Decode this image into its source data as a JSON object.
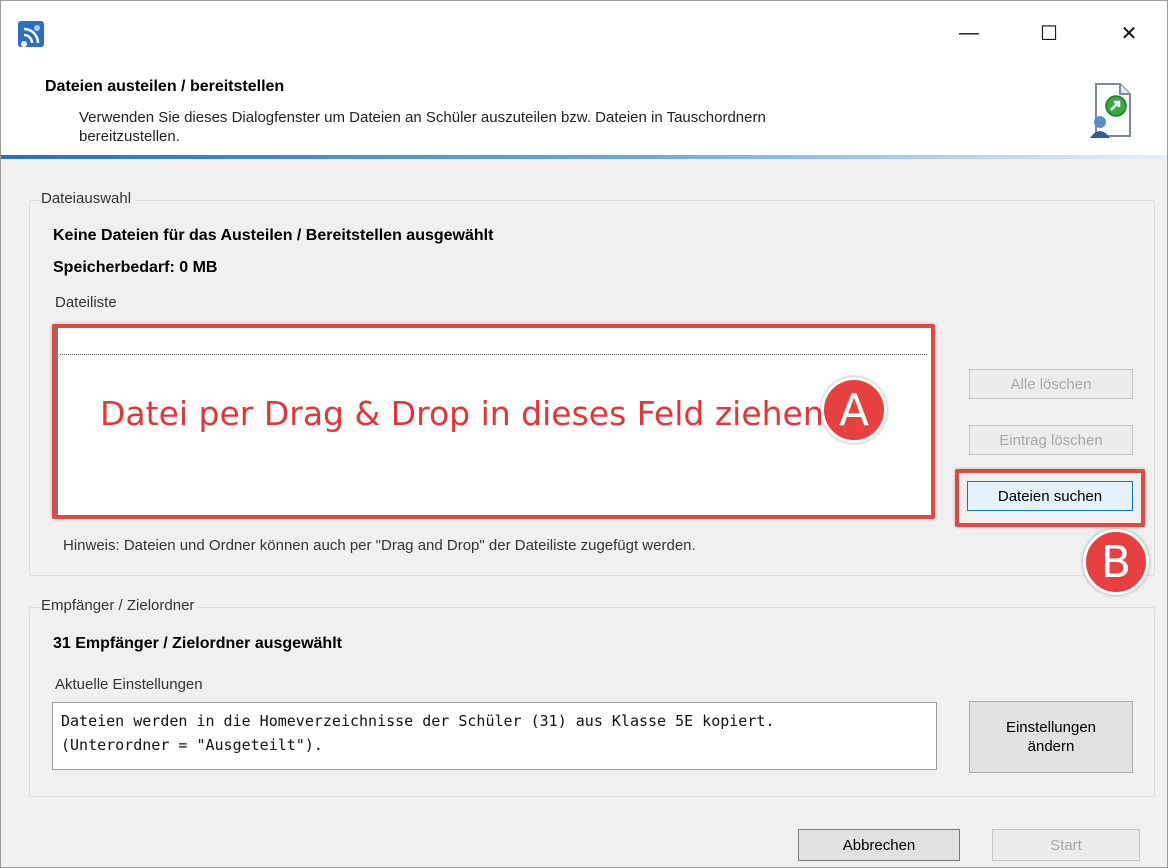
{
  "window": {
    "app_icon": "network-share-icon",
    "controls": {
      "minimize": "—",
      "maximize": "☐",
      "close": "✕"
    }
  },
  "header": {
    "title": "Dateien austeilen / bereitstellen",
    "description_line1": "Verwenden Sie dieses Dialogfenster um Dateien an Schüler auszuteilen bzw. Dateien in Tauschordnern",
    "description_line2": "bereitzustellen.",
    "icon": "file-distribution-icon",
    "accent_color": "#1f73c6"
  },
  "file_selection": {
    "group_label": "Dateiauswahl",
    "status": "Keine Dateien für das Austeilen / Bereitstellen ausgewählt",
    "memory": "Speicherbedarf: 0 MB",
    "list_label": "Dateiliste",
    "drop_hint": "Datei per Drag & Drop in dieses Feld ziehen",
    "marker_a": "A",
    "marker_b": "B",
    "buttons": {
      "delete_all": "Alle löschen",
      "delete_entry": "Eintrag löschen",
      "browse": "Dateien suchen"
    },
    "note": "Hinweis: Dateien und Ordner können auch per \"Drag and Drop\" der Dateiliste zugefügt werden."
  },
  "recipients": {
    "group_label": "Empfänger / Zielordner",
    "status": "31 Empfänger / Zielordner ausgewählt",
    "settings_label": "Aktuelle Einstellungen",
    "settings_line1": "Dateien werden in die Homeverzeichnisse der Schüler (31) aus Klasse 5E kopiert.",
    "settings_line2": "(Unterordner = \"Ausgeteilt\").",
    "change_button_line1": "Einstellungen",
    "change_button_line2": "ändern"
  },
  "footer": {
    "cancel": "Abbrechen",
    "start": "Start"
  },
  "colors": {
    "highlight_red": "#e04848",
    "dialog_bg": "#f0f0f0"
  }
}
